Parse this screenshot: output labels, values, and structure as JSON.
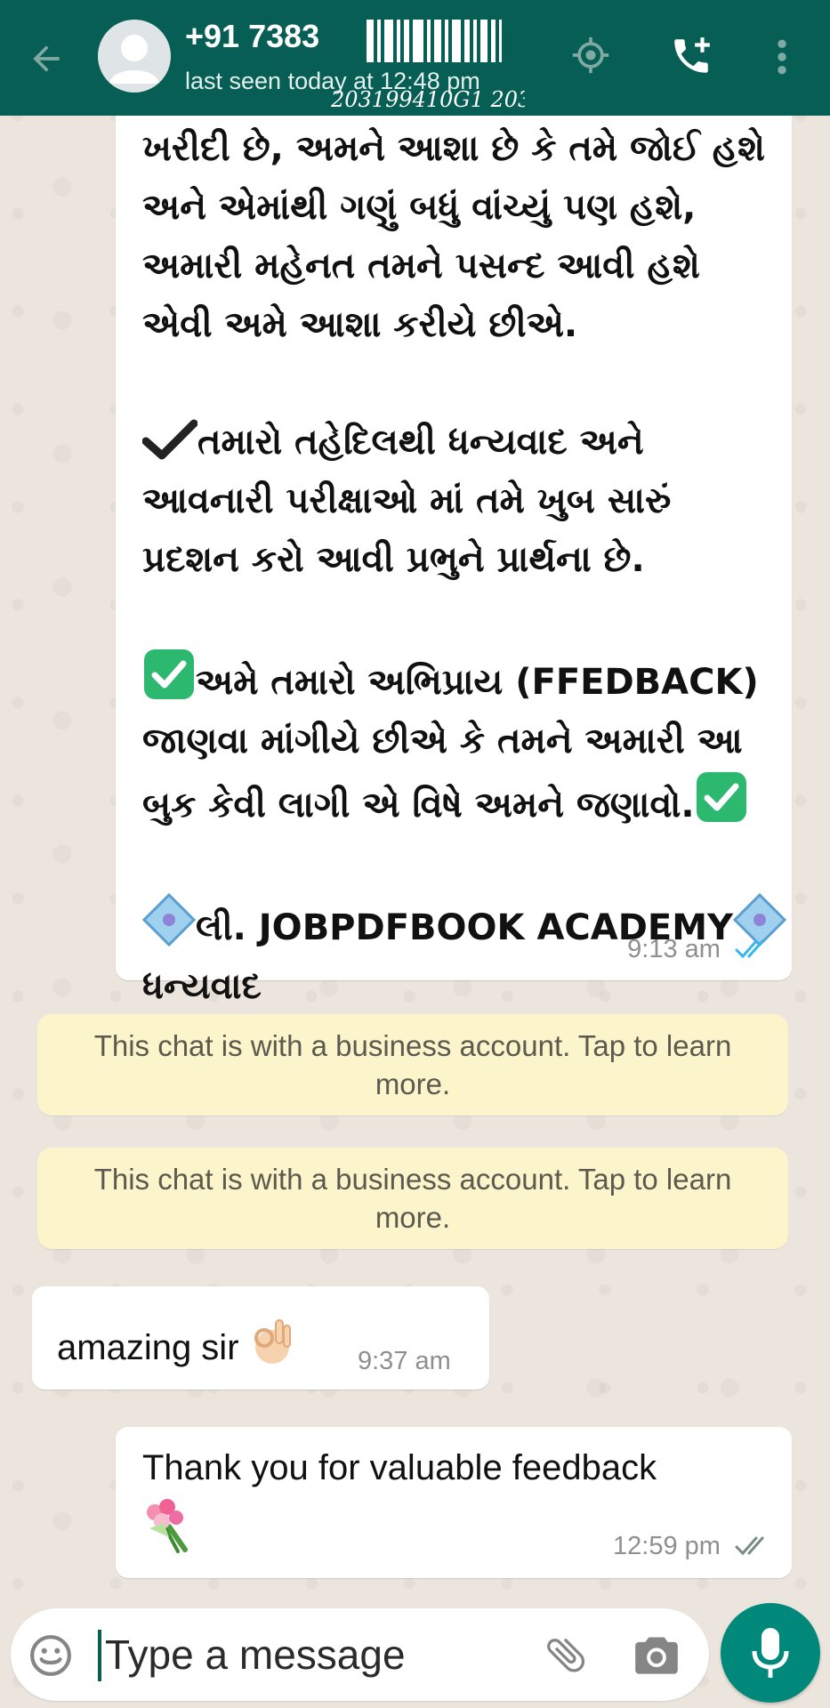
{
  "header": {
    "contact_name": "+91 7383",
    "status": "last seen today at 12:48 pm",
    "watermark_text": "203199410G1 203"
  },
  "messages": [
    {
      "direction": "outgoing",
      "lines": [
        "ખરીદી છે, અમને આશા છે કે તમે જોઈ હશે",
        "અને એમાંથી ગણું બધું વાંચ્યું પણ હશે,",
        "અમારી મહેનત તમને પસન્દ આવી હશે",
        "એવી અમે આશા કરીયે છીએ."
      ],
      "para2": [
        "તમારો તહેદિલથી ધન્યવાદ અને",
        "આવનારી પરીક્ષાઓ માં તમે ખુબ સારું",
        "પ્રદશન કરો આવી પ્રભુને પ્રાર્થના છે."
      ],
      "para3": [
        "અમે તમારો અભિપ્રાય (FFEDBACK)",
        "જાણવા માંગીયે છીએ કે તમને અમારી આ",
        "બુક કેવી લાગી એ વિષે અમને જણાવો."
      ],
      "signature": "લી. JOBPDFBOOK ACADEMY",
      "closing": "ધન્યવાદ",
      "time": "9:13 am"
    },
    {
      "direction": "incoming",
      "text": "amazing sir",
      "emoji": "ok-hand",
      "time": "9:37 am"
    },
    {
      "direction": "outgoing",
      "text": "Thank you for valuable feedback",
      "emoji": "bouquet",
      "time": "12:59 pm"
    }
  ],
  "business_notices": [
    "This chat is with a business account. Tap to learn more.",
    "This chat is with a business account. Tap to learn more."
  ],
  "input": {
    "placeholder": "Type a message"
  },
  "icons": {
    "back": "arrow-back-icon",
    "avatar": "default-avatar-icon",
    "target": "target-icon",
    "call": "add-call-icon",
    "menu": "more-vert-icon",
    "emoji": "emoji-icon",
    "attach": "paperclip-icon",
    "camera": "camera-icon",
    "mic": "mic-icon"
  },
  "colors": {
    "header": "#075e54",
    "chat_background": "#ece5dd",
    "notice_background": "#fcf4cb",
    "mic_button": "#00897b",
    "read_ticks": "#34b7f1"
  }
}
